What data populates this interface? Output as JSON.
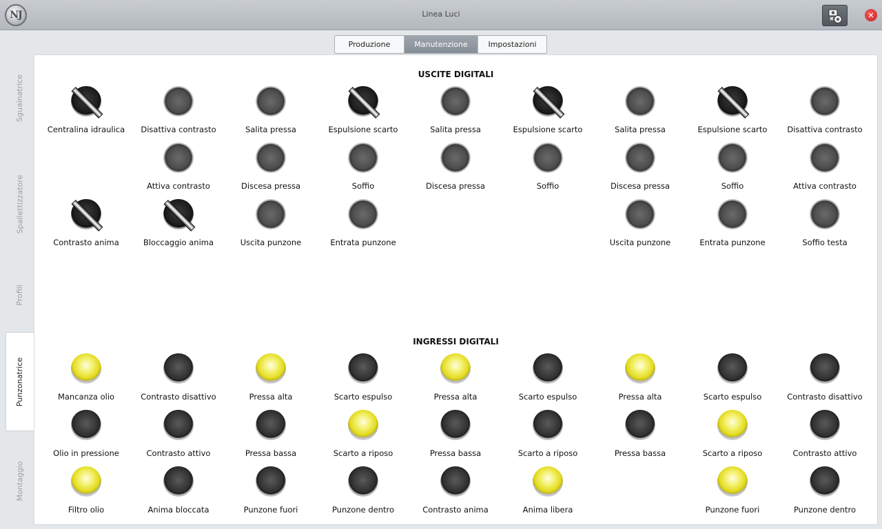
{
  "window": {
    "title": "Linea Luci",
    "logo_text": "NJ"
  },
  "toolbar": {
    "settings_icon": "settings-icon",
    "close_glyph": "✕"
  },
  "tabs": [
    {
      "label": "Produzione",
      "active": false
    },
    {
      "label": "Manutenzione",
      "active": true
    },
    {
      "label": "Impostazioni",
      "active": false
    }
  ],
  "side_tabs": [
    {
      "label": "Sguainatrice",
      "active": false
    },
    {
      "label": "Spallettizzatore",
      "active": false
    },
    {
      "label": "Profili",
      "active": false
    },
    {
      "label": "Punzonatrice",
      "active": true
    },
    {
      "label": "Montaggio",
      "active": false
    }
  ],
  "outputs": {
    "title": "USCITE DIGITALI",
    "rows": [
      [
        {
          "label": "Centralina idraulica",
          "state": "active"
        },
        {
          "label": "Disattiva contrasto",
          "state": "off"
        },
        {
          "label": "Salita pressa",
          "state": "off"
        },
        {
          "label": "Espulsione scarto",
          "state": "active"
        },
        {
          "label": "Salita pressa",
          "state": "off"
        },
        {
          "label": "Espulsione scarto",
          "state": "active"
        },
        {
          "label": "Salita pressa",
          "state": "off"
        },
        {
          "label": "Espulsione scarto",
          "state": "active"
        },
        {
          "label": "Disattiva contrasto",
          "state": "off"
        }
      ],
      [
        null,
        {
          "label": "Attiva contrasto",
          "state": "off"
        },
        {
          "label": "Discesa pressa",
          "state": "off"
        },
        {
          "label": "Soffio",
          "state": "off"
        },
        {
          "label": "Discesa pressa",
          "state": "off"
        },
        {
          "label": "Soffio",
          "state": "off"
        },
        {
          "label": "Discesa pressa",
          "state": "off"
        },
        {
          "label": "Soffio",
          "state": "off"
        },
        {
          "label": "Attiva contrasto",
          "state": "off"
        }
      ],
      [
        {
          "label": "Contrasto anima",
          "state": "active"
        },
        {
          "label": "Bloccaggio anima",
          "state": "active"
        },
        {
          "label": "Uscita punzone",
          "state": "off"
        },
        {
          "label": "Entrata punzone",
          "state": "off"
        },
        null,
        null,
        {
          "label": "Uscita punzone",
          "state": "off"
        },
        {
          "label": "Entrata punzone",
          "state": "off"
        },
        {
          "label": "Soffio testa",
          "state": "off"
        }
      ]
    ]
  },
  "inputs": {
    "title": "INGRESSI DIGITALI",
    "rows": [
      [
        {
          "label": "Mancanza olio",
          "state": "on"
        },
        {
          "label": "Contrasto disattivo",
          "state": "dark"
        },
        {
          "label": "Pressa alta",
          "state": "on"
        },
        {
          "label": "Scarto espulso",
          "state": "dark"
        },
        {
          "label": "Pressa alta",
          "state": "on"
        },
        {
          "label": "Scarto espulso",
          "state": "dark"
        },
        {
          "label": "Pressa alta",
          "state": "on"
        },
        {
          "label": "Scarto espulso",
          "state": "dark"
        },
        {
          "label": "Contrasto disattivo",
          "state": "dark"
        }
      ],
      [
        {
          "label": "Olio in pressione",
          "state": "dark"
        },
        {
          "label": "Contrasto attivo",
          "state": "dark"
        },
        {
          "label": "Pressa bassa",
          "state": "dark"
        },
        {
          "label": "Scarto a riposo",
          "state": "on"
        },
        {
          "label": "Pressa bassa",
          "state": "dark"
        },
        {
          "label": "Scarto a riposo",
          "state": "dark"
        },
        {
          "label": "Pressa bassa",
          "state": "dark"
        },
        {
          "label": "Scarto a riposo",
          "state": "on"
        },
        {
          "label": "Contrasto attivo",
          "state": "dark"
        }
      ],
      [
        {
          "label": "Filtro olio",
          "state": "on"
        },
        {
          "label": "Anima bloccata",
          "state": "dark"
        },
        {
          "label": "Punzone fuori",
          "state": "dark"
        },
        {
          "label": "Punzone dentro",
          "state": "dark"
        },
        {
          "label": "Contrasto anima",
          "state": "dark"
        },
        {
          "label": "Anima libera",
          "state": "on"
        },
        null,
        {
          "label": "Punzone fuori",
          "state": "on"
        },
        {
          "label": "Punzone dentro",
          "state": "dark"
        }
      ]
    ]
  }
}
